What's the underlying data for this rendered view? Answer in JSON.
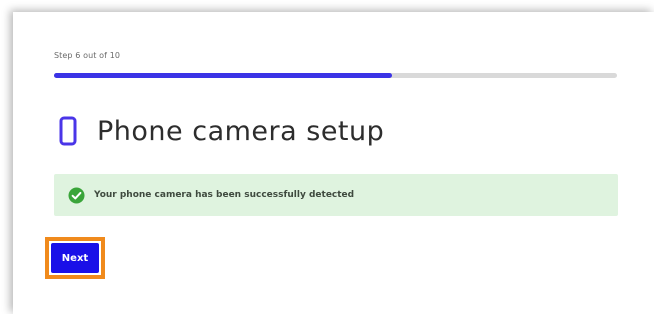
{
  "progress": {
    "step_label": "Step 6 out of 10",
    "current_step": 6,
    "total_steps": 10,
    "fill_fraction": 0.6,
    "fill_color": "#3b33e6"
  },
  "header": {
    "icon": "phone-icon",
    "title": "Phone camera setup"
  },
  "status": {
    "icon": "check-circle-icon",
    "message": "Your phone camera has been successfully detected",
    "color": "#3aa53a"
  },
  "actions": {
    "next_label": "Next",
    "focused": true
  },
  "colors": {
    "accent": "#1a10e8",
    "success_bg": "#dff3df",
    "focus_ring": "#f08a1c"
  }
}
